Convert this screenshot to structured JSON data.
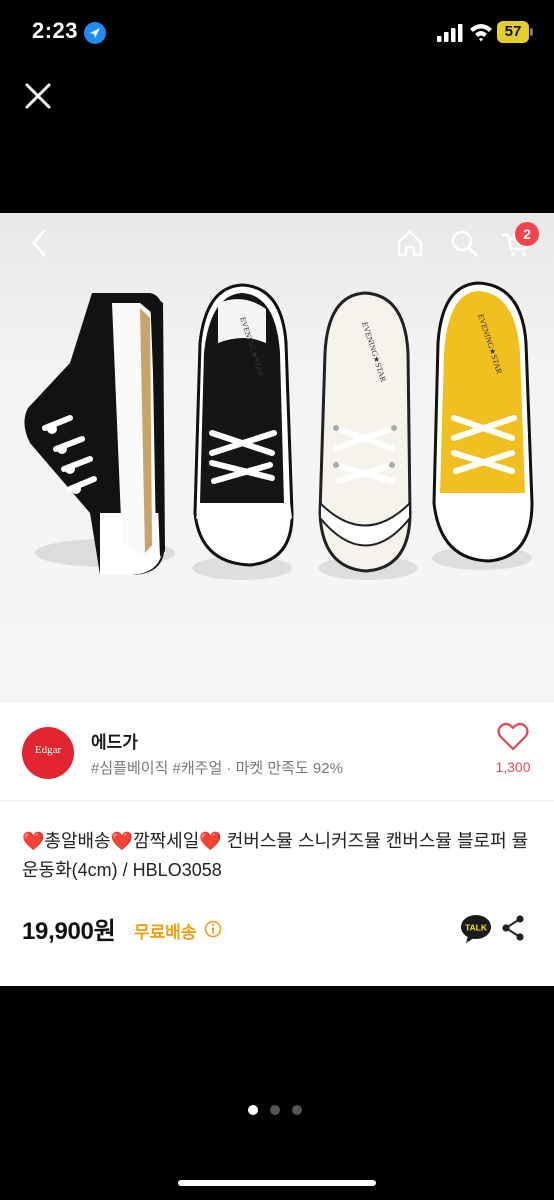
{
  "status_bar": {
    "time": "2:23",
    "battery_level": "57",
    "icons": [
      "location-arrow-icon",
      "signal-bars-icon",
      "wifi-icon",
      "battery-icon"
    ]
  },
  "viewer": {
    "close_icon": "close-icon",
    "page_dots": {
      "total": 3,
      "active_index": 0
    }
  },
  "top_nav": {
    "icons": [
      "back-chevron-icon",
      "home-icon",
      "search-icon",
      "cart-icon"
    ],
    "cart_badge": "2"
  },
  "product_image": {
    "shoe_colors": [
      "#111111",
      "#151515",
      "#f4f1ea",
      "#f0c020"
    ],
    "shoe_brand_text": "EVENING★STAR"
  },
  "shop": {
    "logo_text": "Edgar",
    "logo_color": "#e22430",
    "name": "에드가",
    "tags": "#심플베이직 #캐주얼 · 마켓 만족도 92%",
    "like_count": "1,300"
  },
  "product": {
    "title": "❤️총알배송❤️깜짝세일❤️ 컨버스뮬 스니커즈뮬 캔버스뮬 블로퍼 뮬운동화(4cm) / HBLO3058",
    "price": "19,900원",
    "shipping": "무료배송",
    "kakao_label": "TALK"
  },
  "colors": {
    "accent_red": "#f2434f",
    "like_pink": "#e0475c",
    "shipping_orange": "#f0a017",
    "kakao_yellow": "#f7e600"
  }
}
